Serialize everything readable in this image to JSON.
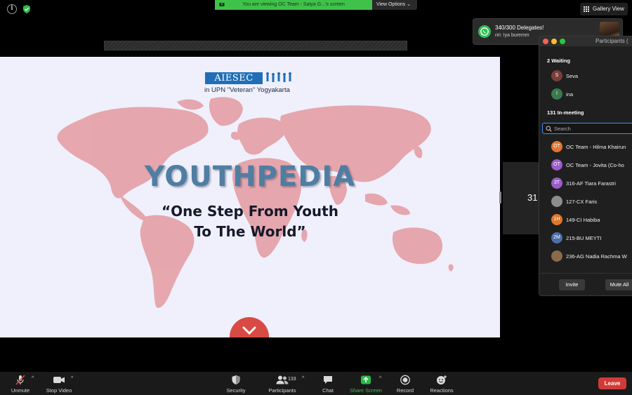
{
  "top": {
    "share_banner": "You are viewing OC Team - Satya G...'s screen",
    "view_options": "View Options",
    "gallery_view": "Gallery View"
  },
  "notification": {
    "title": "340/300 Delegates!",
    "body": "riri: Iya buremm"
  },
  "slide": {
    "logo": "AIESEC",
    "logo_sub": "in UPN \"Veteran\" Yogyakarta",
    "headline": "YOUTHPEDIA",
    "tagline_line1": "“One Step From Youth",
    "tagline_line2": "To The World”",
    "map_color": "#e5a3aa",
    "button_color": "#d94a45"
  },
  "video_tile": {
    "label": "31"
  },
  "participants_panel": {
    "title": "Participants (",
    "waiting_label": "2 Waiting",
    "waiting": [
      {
        "initial": "S",
        "name": "Seva",
        "color": "#7a3f36"
      },
      {
        "initial": "I",
        "name": "ina",
        "color": "#3a7a4d"
      }
    ],
    "in_meeting_label": "131 In-meeting",
    "search_placeholder": "Search",
    "members": [
      {
        "initials": "OT",
        "name": "OC Team - Hilma Khairun",
        "color": "#e0772e"
      },
      {
        "initials": "OT",
        "name": "OC Team - Jovita (Co-ho",
        "color": "#9b5cc9"
      },
      {
        "initials": "3T",
        "name": "316-AF Tiara Farastri",
        "color": "#9b5cc9"
      },
      {
        "initials": "",
        "name": "127-CX Faris",
        "color": "#8d8d8d"
      },
      {
        "initials": "1H",
        "name": "149-CI Habiba",
        "color": "#e0772e"
      },
      {
        "initials": "2M",
        "name": "215-BU MEYTI",
        "color": "#4c6fa6"
      },
      {
        "initials": "",
        "name": "236-AG Nadia Rachma W",
        "color": "#8a6a4a"
      }
    ],
    "invite": "Invite",
    "mute_all": "Mute All"
  },
  "toolbar": {
    "unmute": "Unmute",
    "stop_video": "Stop Video",
    "security": "Security",
    "participants": "Participants",
    "participants_count": "133",
    "chat": "Chat",
    "share_screen": "Share Screen",
    "record": "Record",
    "reactions": "Reactions",
    "leave": "Leave"
  }
}
